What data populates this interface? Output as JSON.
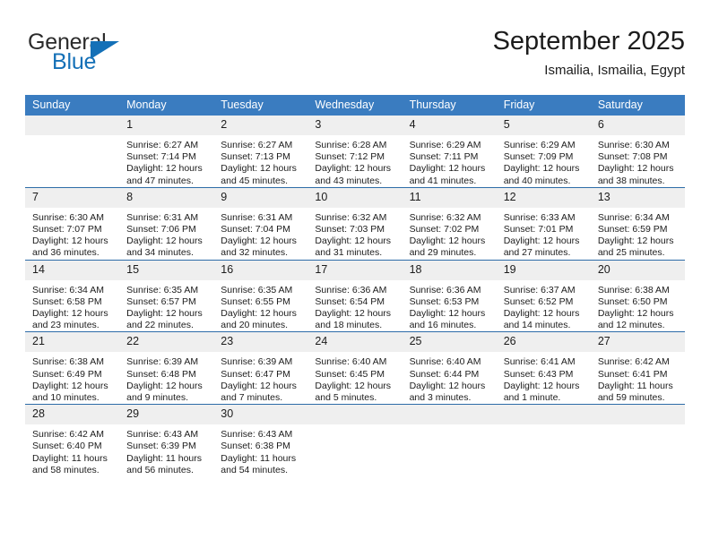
{
  "brand": {
    "name_part1": "General",
    "name_part2": "Blue"
  },
  "header": {
    "title": "September 2025",
    "location": "Ismailia, Ismailia, Egypt"
  },
  "colors": {
    "header_blue": "#3a7cc0",
    "row_border_blue": "#2d6ca8",
    "daynum_band": "#efefef",
    "brand_blue": "#1470b7"
  },
  "calendar": {
    "weekday_headers": [
      "Sunday",
      "Monday",
      "Tuesday",
      "Wednesday",
      "Thursday",
      "Friday",
      "Saturday"
    ],
    "weeks": [
      [
        {
          "day": "",
          "sunrise": "",
          "sunset": "",
          "daylight_line1": "",
          "daylight_line2": ""
        },
        {
          "day": "1",
          "sunrise": "Sunrise: 6:27 AM",
          "sunset": "Sunset: 7:14 PM",
          "daylight_line1": "Daylight: 12 hours",
          "daylight_line2": "and 47 minutes."
        },
        {
          "day": "2",
          "sunrise": "Sunrise: 6:27 AM",
          "sunset": "Sunset: 7:13 PM",
          "daylight_line1": "Daylight: 12 hours",
          "daylight_line2": "and 45 minutes."
        },
        {
          "day": "3",
          "sunrise": "Sunrise: 6:28 AM",
          "sunset": "Sunset: 7:12 PM",
          "daylight_line1": "Daylight: 12 hours",
          "daylight_line2": "and 43 minutes."
        },
        {
          "day": "4",
          "sunrise": "Sunrise: 6:29 AM",
          "sunset": "Sunset: 7:11 PM",
          "daylight_line1": "Daylight: 12 hours",
          "daylight_line2": "and 41 minutes."
        },
        {
          "day": "5",
          "sunrise": "Sunrise: 6:29 AM",
          "sunset": "Sunset: 7:09 PM",
          "daylight_line1": "Daylight: 12 hours",
          "daylight_line2": "and 40 minutes."
        },
        {
          "day": "6",
          "sunrise": "Sunrise: 6:30 AM",
          "sunset": "Sunset: 7:08 PM",
          "daylight_line1": "Daylight: 12 hours",
          "daylight_line2": "and 38 minutes."
        }
      ],
      [
        {
          "day": "7",
          "sunrise": "Sunrise: 6:30 AM",
          "sunset": "Sunset: 7:07 PM",
          "daylight_line1": "Daylight: 12 hours",
          "daylight_line2": "and 36 minutes."
        },
        {
          "day": "8",
          "sunrise": "Sunrise: 6:31 AM",
          "sunset": "Sunset: 7:06 PM",
          "daylight_line1": "Daylight: 12 hours",
          "daylight_line2": "and 34 minutes."
        },
        {
          "day": "9",
          "sunrise": "Sunrise: 6:31 AM",
          "sunset": "Sunset: 7:04 PM",
          "daylight_line1": "Daylight: 12 hours",
          "daylight_line2": "and 32 minutes."
        },
        {
          "day": "10",
          "sunrise": "Sunrise: 6:32 AM",
          "sunset": "Sunset: 7:03 PM",
          "daylight_line1": "Daylight: 12 hours",
          "daylight_line2": "and 31 minutes."
        },
        {
          "day": "11",
          "sunrise": "Sunrise: 6:32 AM",
          "sunset": "Sunset: 7:02 PM",
          "daylight_line1": "Daylight: 12 hours",
          "daylight_line2": "and 29 minutes."
        },
        {
          "day": "12",
          "sunrise": "Sunrise: 6:33 AM",
          "sunset": "Sunset: 7:01 PM",
          "daylight_line1": "Daylight: 12 hours",
          "daylight_line2": "and 27 minutes."
        },
        {
          "day": "13",
          "sunrise": "Sunrise: 6:34 AM",
          "sunset": "Sunset: 6:59 PM",
          "daylight_line1": "Daylight: 12 hours",
          "daylight_line2": "and 25 minutes."
        }
      ],
      [
        {
          "day": "14",
          "sunrise": "Sunrise: 6:34 AM",
          "sunset": "Sunset: 6:58 PM",
          "daylight_line1": "Daylight: 12 hours",
          "daylight_line2": "and 23 minutes."
        },
        {
          "day": "15",
          "sunrise": "Sunrise: 6:35 AM",
          "sunset": "Sunset: 6:57 PM",
          "daylight_line1": "Daylight: 12 hours",
          "daylight_line2": "and 22 minutes."
        },
        {
          "day": "16",
          "sunrise": "Sunrise: 6:35 AM",
          "sunset": "Sunset: 6:55 PM",
          "daylight_line1": "Daylight: 12 hours",
          "daylight_line2": "and 20 minutes."
        },
        {
          "day": "17",
          "sunrise": "Sunrise: 6:36 AM",
          "sunset": "Sunset: 6:54 PM",
          "daylight_line1": "Daylight: 12 hours",
          "daylight_line2": "and 18 minutes."
        },
        {
          "day": "18",
          "sunrise": "Sunrise: 6:36 AM",
          "sunset": "Sunset: 6:53 PM",
          "daylight_line1": "Daylight: 12 hours",
          "daylight_line2": "and 16 minutes."
        },
        {
          "day": "19",
          "sunrise": "Sunrise: 6:37 AM",
          "sunset": "Sunset: 6:52 PM",
          "daylight_line1": "Daylight: 12 hours",
          "daylight_line2": "and 14 minutes."
        },
        {
          "day": "20",
          "sunrise": "Sunrise: 6:38 AM",
          "sunset": "Sunset: 6:50 PM",
          "daylight_line1": "Daylight: 12 hours",
          "daylight_line2": "and 12 minutes."
        }
      ],
      [
        {
          "day": "21",
          "sunrise": "Sunrise: 6:38 AM",
          "sunset": "Sunset: 6:49 PM",
          "daylight_line1": "Daylight: 12 hours",
          "daylight_line2": "and 10 minutes."
        },
        {
          "day": "22",
          "sunrise": "Sunrise: 6:39 AM",
          "sunset": "Sunset: 6:48 PM",
          "daylight_line1": "Daylight: 12 hours",
          "daylight_line2": "and 9 minutes."
        },
        {
          "day": "23",
          "sunrise": "Sunrise: 6:39 AM",
          "sunset": "Sunset: 6:47 PM",
          "daylight_line1": "Daylight: 12 hours",
          "daylight_line2": "and 7 minutes."
        },
        {
          "day": "24",
          "sunrise": "Sunrise: 6:40 AM",
          "sunset": "Sunset: 6:45 PM",
          "daylight_line1": "Daylight: 12 hours",
          "daylight_line2": "and 5 minutes."
        },
        {
          "day": "25",
          "sunrise": "Sunrise: 6:40 AM",
          "sunset": "Sunset: 6:44 PM",
          "daylight_line1": "Daylight: 12 hours",
          "daylight_line2": "and 3 minutes."
        },
        {
          "day": "26",
          "sunrise": "Sunrise: 6:41 AM",
          "sunset": "Sunset: 6:43 PM",
          "daylight_line1": "Daylight: 12 hours",
          "daylight_line2": "and 1 minute."
        },
        {
          "day": "27",
          "sunrise": "Sunrise: 6:42 AM",
          "sunset": "Sunset: 6:41 PM",
          "daylight_line1": "Daylight: 11 hours",
          "daylight_line2": "and 59 minutes."
        }
      ],
      [
        {
          "day": "28",
          "sunrise": "Sunrise: 6:42 AM",
          "sunset": "Sunset: 6:40 PM",
          "daylight_line1": "Daylight: 11 hours",
          "daylight_line2": "and 58 minutes."
        },
        {
          "day": "29",
          "sunrise": "Sunrise: 6:43 AM",
          "sunset": "Sunset: 6:39 PM",
          "daylight_line1": "Daylight: 11 hours",
          "daylight_line2": "and 56 minutes."
        },
        {
          "day": "30",
          "sunrise": "Sunrise: 6:43 AM",
          "sunset": "Sunset: 6:38 PM",
          "daylight_line1": "Daylight: 11 hours",
          "daylight_line2": "and 54 minutes."
        },
        {
          "day": "",
          "sunrise": "",
          "sunset": "",
          "daylight_line1": "",
          "daylight_line2": ""
        },
        {
          "day": "",
          "sunrise": "",
          "sunset": "",
          "daylight_line1": "",
          "daylight_line2": ""
        },
        {
          "day": "",
          "sunrise": "",
          "sunset": "",
          "daylight_line1": "",
          "daylight_line2": ""
        },
        {
          "day": "",
          "sunrise": "",
          "sunset": "",
          "daylight_line1": "",
          "daylight_line2": ""
        }
      ]
    ]
  }
}
